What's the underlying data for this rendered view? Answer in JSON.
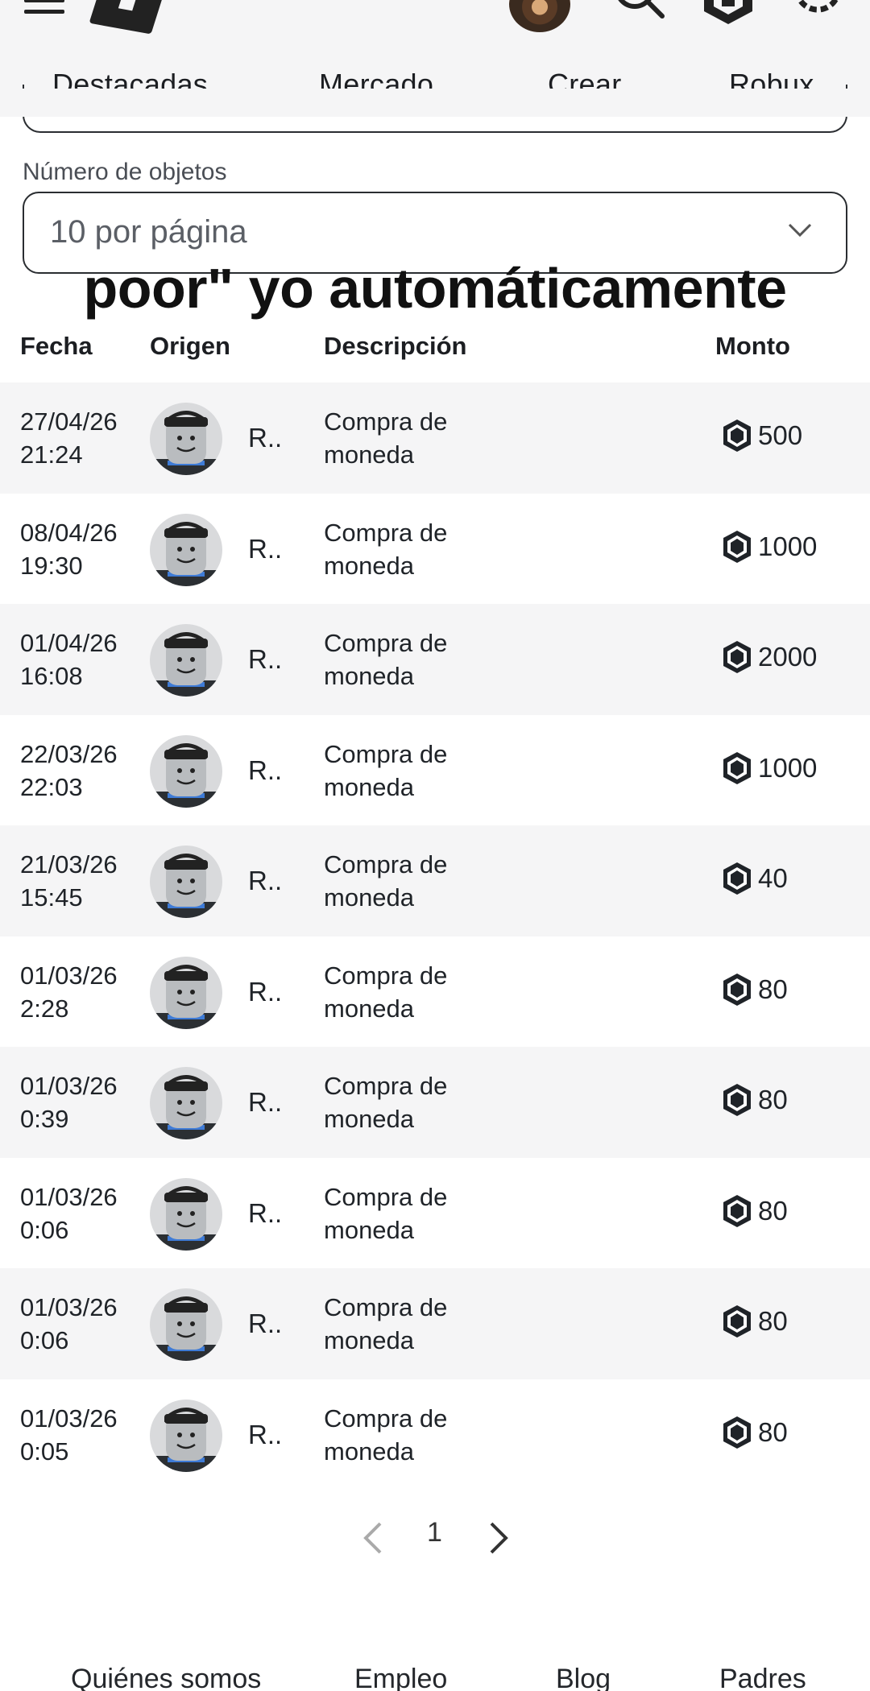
{
  "header": {
    "tabs": [
      "Destacadas",
      "Mercado",
      "Crear",
      "Robux"
    ]
  },
  "filters": {
    "objects_label": "Número de objetos",
    "per_page_value": "10 por página"
  },
  "overlay_caption": "poor\" yo automáticamente",
  "table": {
    "columns": [
      "Fecha",
      "Origen",
      "Descripción",
      "Monto"
    ],
    "rows": [
      {
        "date": "27/04/26",
        "time": "21:24",
        "origin": "R..",
        "desc1": "Compra de",
        "desc2": "moneda",
        "amount": "500"
      },
      {
        "date": "08/04/26",
        "time": "19:30",
        "origin": "R..",
        "desc1": "Compra de",
        "desc2": "moneda",
        "amount": "1000"
      },
      {
        "date": "01/04/26",
        "time": "16:08",
        "origin": "R..",
        "desc1": "Compra de",
        "desc2": "moneda",
        "amount": "2000"
      },
      {
        "date": "22/03/26",
        "time": "22:03",
        "origin": "R..",
        "desc1": "Compra de",
        "desc2": "moneda",
        "amount": "1000"
      },
      {
        "date": "21/03/26",
        "time": "15:45",
        "origin": "R..",
        "desc1": "Compra de",
        "desc2": "moneda",
        "amount": "40"
      },
      {
        "date": "01/03/26",
        "time": "2:28",
        "origin": "R..",
        "desc1": "Compra de",
        "desc2": "moneda",
        "amount": "80"
      },
      {
        "date": "01/03/26",
        "time": "0:39",
        "origin": "R..",
        "desc1": "Compra de",
        "desc2": "moneda",
        "amount": "80"
      },
      {
        "date": "01/03/26",
        "time": "0:06",
        "origin": "R..",
        "desc1": "Compra de",
        "desc2": "moneda",
        "amount": "80"
      },
      {
        "date": "01/03/26",
        "time": "0:06",
        "origin": "R..",
        "desc1": "Compra de",
        "desc2": "moneda",
        "amount": "80"
      },
      {
        "date": "01/03/26",
        "time": "0:05",
        "origin": "R..",
        "desc1": "Compra de",
        "desc2": "moneda",
        "amount": "80"
      }
    ]
  },
  "pagination": {
    "page": "1"
  },
  "footer": {
    "links": [
      "Quiénes somos",
      "Empleo",
      "Blog",
      "Padres"
    ]
  },
  "icons": [
    "menu-icon",
    "roblox-logo",
    "avatar",
    "search-icon",
    "robux-icon",
    "gear-icon",
    "chevron-down-icon",
    "chevron-left-icon",
    "chevron-right-icon"
  ]
}
